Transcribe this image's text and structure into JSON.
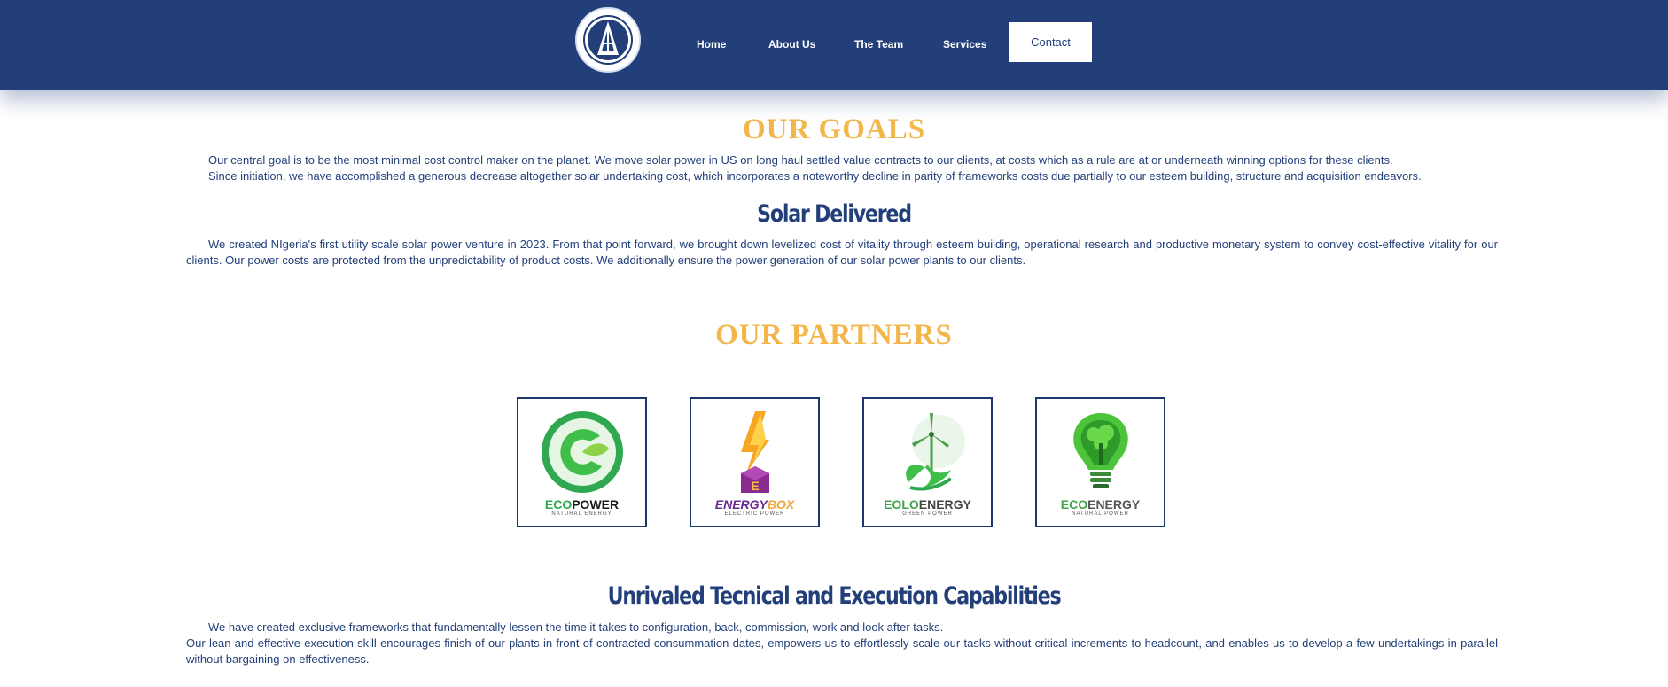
{
  "header": {
    "nav": [
      {
        "label": "Home"
      },
      {
        "label": "About Us"
      },
      {
        "label": "The Team"
      },
      {
        "label": "Services"
      }
    ],
    "contact_label": "Contact"
  },
  "goals": {
    "title": "OUR GOALS",
    "p1": "Our central goal is to be the most minimal cost control maker on the planet. We move solar power in US on long haul settled value contracts to our clients, at costs which as a rule are at or underneath winning options for these clients.",
    "p2": "Since initiation, we have accomplished a generous decrease altogether solar undertaking cost, which incorporates a noteworthy decline in parity of frameworks costs due partially to our esteem building, structure and acquisition endeavors."
  },
  "solar": {
    "title": "Solar Delivered",
    "p1": "We created NIgeria's first utility scale solar power venture in 2023. From that point forward, we brought down levelized cost of vitality through esteem building, operational research and productive monetary system to convey cost-effective vitality for our clients. Our power costs are protected from the unpredictability of product costs. We additionally ensure the power generation of our solar power plants to our clients."
  },
  "partners": {
    "title": "OUR PARTNERS",
    "items": [
      {
        "name_a": "ECO",
        "name_b": "POWER",
        "tagline": "NATURAL ENERGY",
        "icon": "eco-power-logo-icon"
      },
      {
        "name_a": "ENERGY",
        "name_b": "BOX",
        "tagline": "ELECTRIC POWER",
        "icon": "energy-box-logo-icon"
      },
      {
        "name_a": "EOLO",
        "name_b": "ENERGY",
        "tagline": "GREEN POWER",
        "icon": "eolo-energy-logo-icon"
      },
      {
        "name_a": "ECO",
        "name_b": "ENERGY",
        "tagline": "NATURAL POWER",
        "icon": "eco-energy-logo-icon"
      }
    ]
  },
  "capabilities": {
    "title": "Unrivaled Tecnical and Execution Capabilities",
    "p1": "We have created exclusive frameworks that fundamentally lessen the time it takes to configuration, back, commission, work and look after tasks.",
    "p2": "Our lean and effective execution skill encourages finish of our plants in front of contracted consummation dates, empowers us to effortlessly scale our tasks without critical increments to headcount, and enables us to develop a few undertakings in parallel without bargaining on effectiveness."
  },
  "colors": {
    "navy": "#223f7a",
    "gold": "#f3b64b",
    "white": "#ffffff"
  }
}
